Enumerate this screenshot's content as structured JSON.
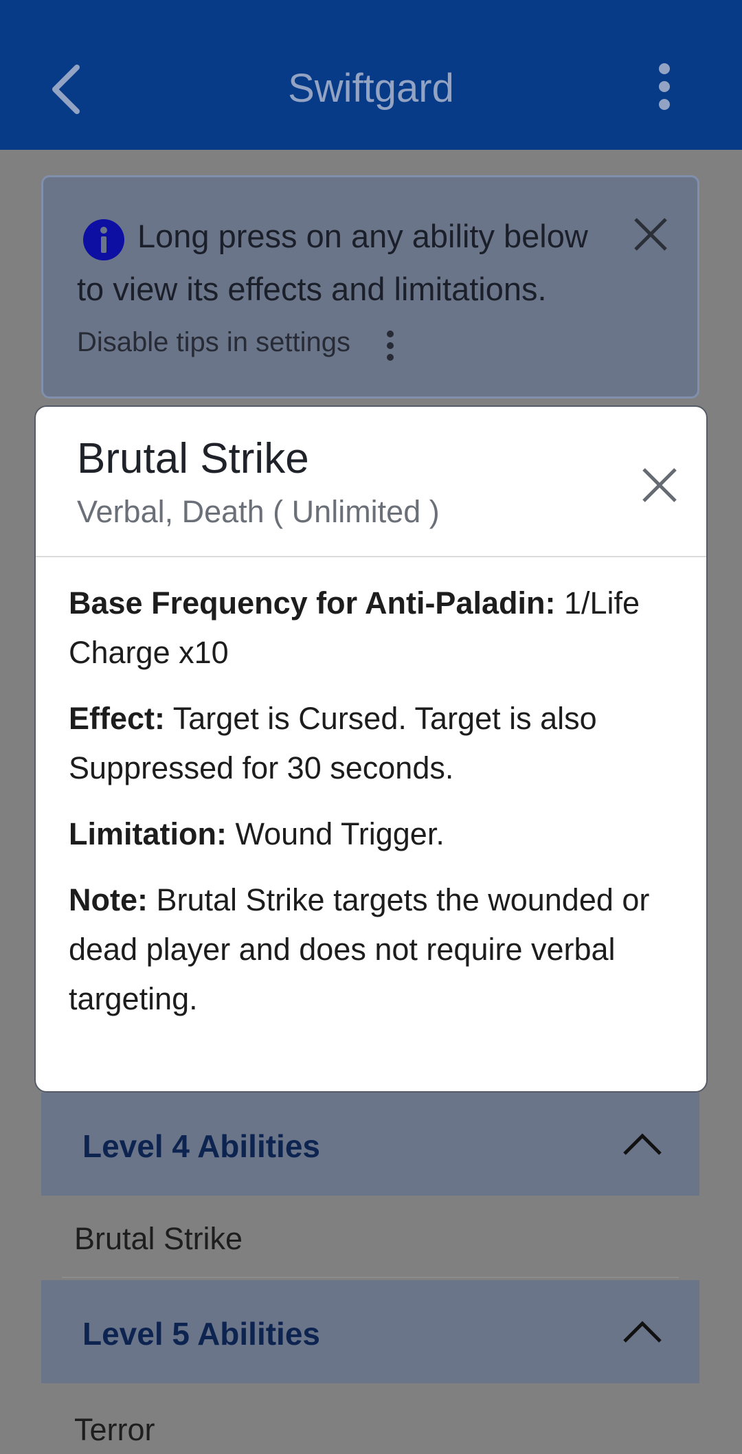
{
  "app_bar": {
    "title": "Swiftgard",
    "back_icon": "chevron-left-icon",
    "menu_icon": "more-vertical-icon",
    "background": "#073a87"
  },
  "tip": {
    "line1": "Long press on any ability below",
    "line2": "to view its effects and limitations.",
    "settings_hint": "Disable tips in settings",
    "info_icon": "info-icon",
    "close_icon": "close-icon"
  },
  "dialog": {
    "title": "Brutal Strike",
    "subtitle": "Verbal, Death ( Unlimited )",
    "close_icon": "close-icon",
    "fields": [
      {
        "label": "Base Frequency for Anti-Paladin:",
        "value": "1/Life Charge x10"
      },
      {
        "label": "Effect:",
        "value": "Target is Cursed. Target is also Suppressed for 30 seconds."
      },
      {
        "label": "Limitation:",
        "value": "Wound Trigger."
      },
      {
        "label": "Note:",
        "value": "Brutal Strike targets the wounded or dead player and does not require verbal targeting."
      }
    ]
  },
  "sections": [
    {
      "label": "Level 4 Abilities",
      "items": [
        "Brutal Strike"
      ]
    },
    {
      "label": "Level 5 Abilities",
      "items": [
        "Terror"
      ]
    }
  ]
}
